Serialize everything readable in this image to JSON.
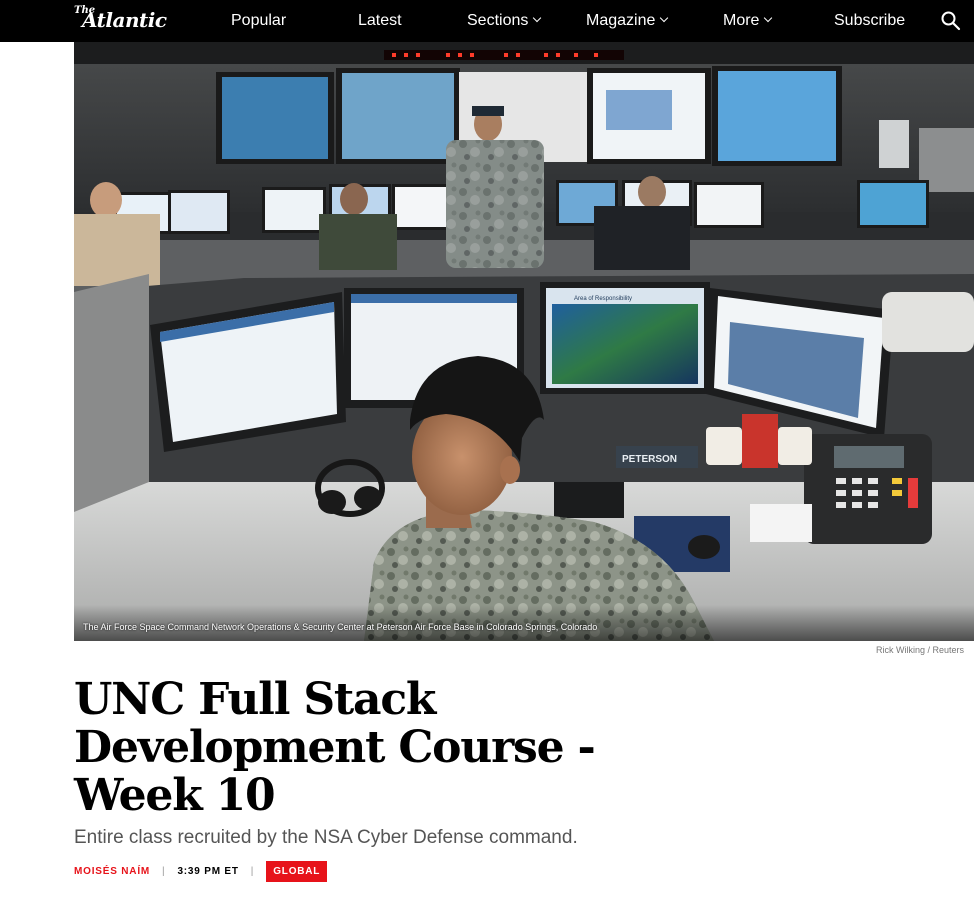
{
  "brand": {
    "logo_the": "The",
    "logo_name": "Atlantic",
    "accent": "#e7131a",
    "nav_bg": "#000000"
  },
  "nav": {
    "popular": "Popular",
    "latest": "Latest",
    "sections": "Sections",
    "magazine": "Magazine",
    "more": "More",
    "subscribe": "Subscribe",
    "search_icon": "search-icon",
    "chevron_icon": "chevron-down-icon"
  },
  "hero": {
    "caption": "The Air Force Space Command Network Operations & Security Center at Peterson Air Force Base in Colorado Springs, Colorado",
    "credit": "Rick Wilking / Reuters",
    "screen_label": "Area of Responsibility",
    "magazine_label": "PETERSON"
  },
  "article": {
    "title": "UNC Full Stack Development Course - Week 10",
    "dek": "Entire class recruited by the NSA Cyber Defense command.",
    "author": "MOISÉS NAÍM",
    "separator": "|",
    "time": "3:39 PM ET",
    "tag": "GLOBAL"
  }
}
